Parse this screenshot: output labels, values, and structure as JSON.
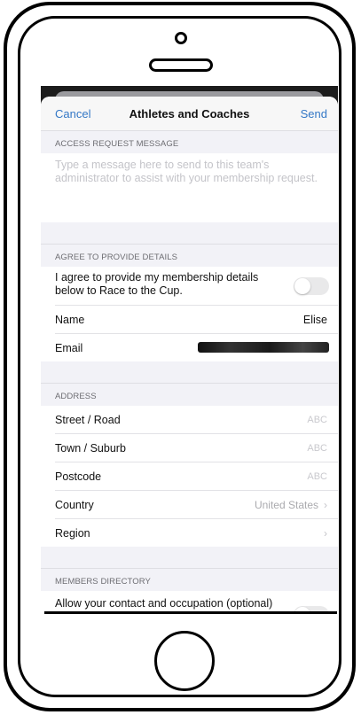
{
  "nav": {
    "cancel_label": "Cancel",
    "title": "Athletes and Coaches",
    "send_label": "Send"
  },
  "access_request": {
    "header": "ACCESS REQUEST MESSAGE",
    "placeholder": "Type a message here to send to this team's administrator to assist with your membership request.",
    "value": ""
  },
  "agree": {
    "header": "AGREE TO PROVIDE DETAILS",
    "toggle_label": "I agree to provide my membership details below to Race to the Cup.",
    "toggle_on": false,
    "name_label": "Name",
    "name_value": "Elise",
    "email_label": "Email",
    "email_redacted": true
  },
  "address": {
    "header": "ADDRESS",
    "street_label": "Street / Road",
    "street_placeholder": "ABC",
    "town_label": "Town / Suburb",
    "town_placeholder": "ABC",
    "postcode_label": "Postcode",
    "postcode_placeholder": "ABC",
    "country_label": "Country",
    "country_value": "United States",
    "region_label": "Region",
    "region_value": ""
  },
  "members_directory": {
    "header": "MEMBERS DIRECTORY",
    "toggle_label": "Allow your contact and occupation (optional) details to be visible in the members directory of this app?",
    "toggle_on": false
  },
  "icons": {
    "chevron": "chevron-right-icon"
  }
}
